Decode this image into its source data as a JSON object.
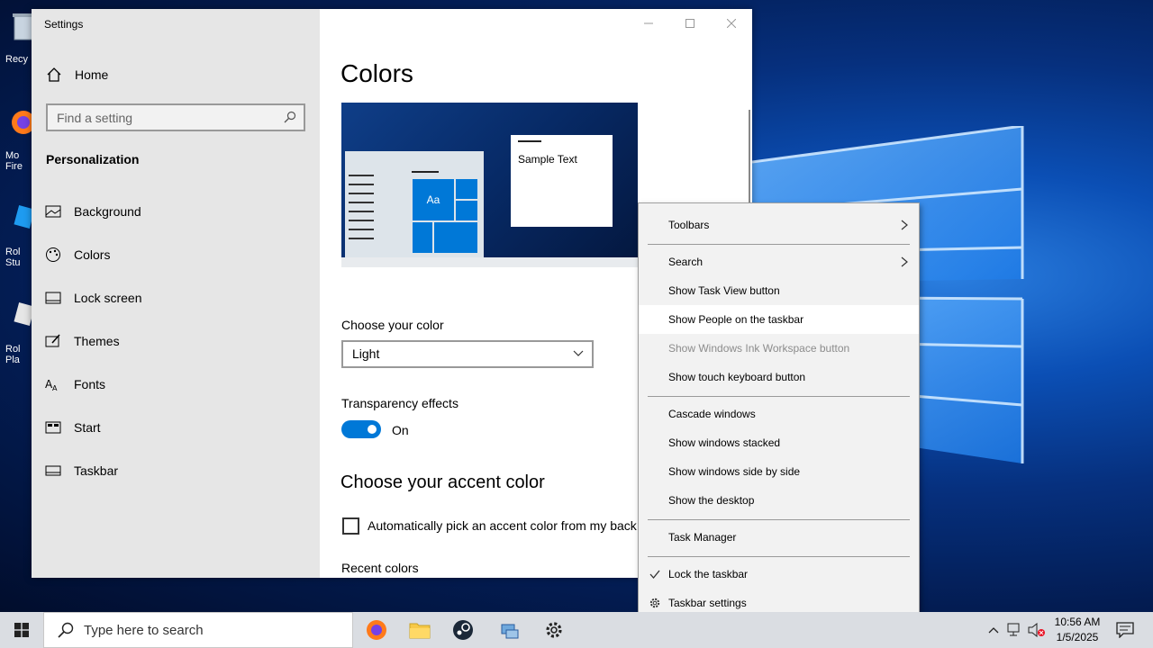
{
  "desktop": {
    "icons": [
      {
        "label": "Recy",
        "name": "recycle-bin"
      },
      {
        "label": "Mo\nFire",
        "name": "firefox"
      },
      {
        "label": "Rol\nStu",
        "name": "roblox-studio"
      },
      {
        "label": "Rol\nPla",
        "name": "roblox-player"
      }
    ]
  },
  "settings": {
    "window_title": "Settings",
    "home_label": "Home",
    "search_placeholder": "Find a setting",
    "section_title": "Personalization",
    "nav": [
      {
        "label": "Background",
        "icon": "picture-icon"
      },
      {
        "label": "Colors",
        "icon": "palette-icon"
      },
      {
        "label": "Lock screen",
        "icon": "lock-screen-icon"
      },
      {
        "label": "Themes",
        "icon": "themes-icon"
      },
      {
        "label": "Fonts",
        "icon": "fonts-icon"
      },
      {
        "label": "Start",
        "icon": "start-icon"
      },
      {
        "label": "Taskbar",
        "icon": "taskbar-icon"
      }
    ],
    "page_title": "Colors",
    "preview": {
      "sample_text": "Sample Text",
      "tile_label": "Aa"
    },
    "choose_color_label": "Choose your color",
    "choose_color_value": "Light",
    "transparency_label": "Transparency effects",
    "transparency_state": "On",
    "accent_heading": "Choose your accent color",
    "auto_accent_label": "Automatically pick an accent color from my back",
    "recent_colors_label": "Recent colors",
    "accent": "#0078d7"
  },
  "context_menu": {
    "items": [
      {
        "label": "Toolbars",
        "submenu": true
      },
      {
        "label": "Search",
        "submenu": true
      },
      {
        "label": "Show Task View button"
      },
      {
        "label": "Show People on the taskbar",
        "highlighted": true
      },
      {
        "label": "Show Windows Ink Workspace button",
        "disabled": true
      },
      {
        "label": "Show touch keyboard button"
      },
      {
        "label": "Cascade windows"
      },
      {
        "label": "Show windows stacked"
      },
      {
        "label": "Show windows side by side"
      },
      {
        "label": "Show the desktop"
      },
      {
        "label": "Task Manager"
      },
      {
        "label": "Lock the taskbar",
        "checked": true
      },
      {
        "label": "Taskbar settings",
        "icon": "gear-icon"
      }
    ]
  },
  "taskbar": {
    "search_placeholder": "Type here to search",
    "apps": [
      "firefox",
      "file-explorer",
      "steam",
      "network-app",
      "settings"
    ],
    "time": "10:56 AM",
    "date": "1/5/2025"
  }
}
